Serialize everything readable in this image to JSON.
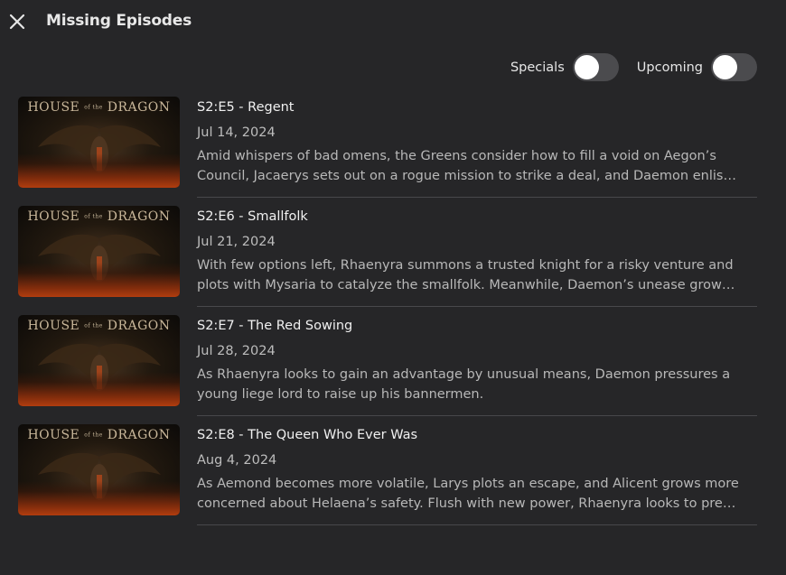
{
  "header": {
    "title": "Missing Episodes"
  },
  "toggles": {
    "specials_label": "Specials",
    "specials_on": false,
    "upcoming_label": "Upcoming",
    "upcoming_on": false
  },
  "thumbnail": {
    "logo_left": "HOUSE",
    "logo_mid": "of the",
    "logo_right": "DRAGON"
  },
  "episodes": [
    {
      "title": "S2:E5 - Regent",
      "date": "Jul 14, 2024",
      "description": "Amid whispers of bad omens, the Greens consider how to fill a void on Aegon’s Council, Jacaerys sets out on a rogue mission to strike a deal, and Daemon enlists Lord Willem..."
    },
    {
      "title": "S2:E6 - Smallfolk",
      "date": "Jul 21, 2024",
      "description": "With few options left, Rhaenyra summons a trusted knight for a risky venture and plots with Mysaria to catalyze the smallfolk. Meanwhile, Daemon’s unease grows, and Aemo..."
    },
    {
      "title": "S2:E7 - The Red Sowing",
      "date": "Jul 28, 2024",
      "description": "As Rhaenyra looks to gain an advantage by unusual means, Daemon pressures a young liege lord to raise up his bannermen."
    },
    {
      "title": "S2:E8 - The Queen Who Ever Was",
      "date": "Aug 4, 2024",
      "description": "As Aemond becomes more volatile, Larys plots an escape, and Alicent grows more concerned about Helaena’s safety. Flush with new power, Rhaenyra looks to press her..."
    }
  ]
}
